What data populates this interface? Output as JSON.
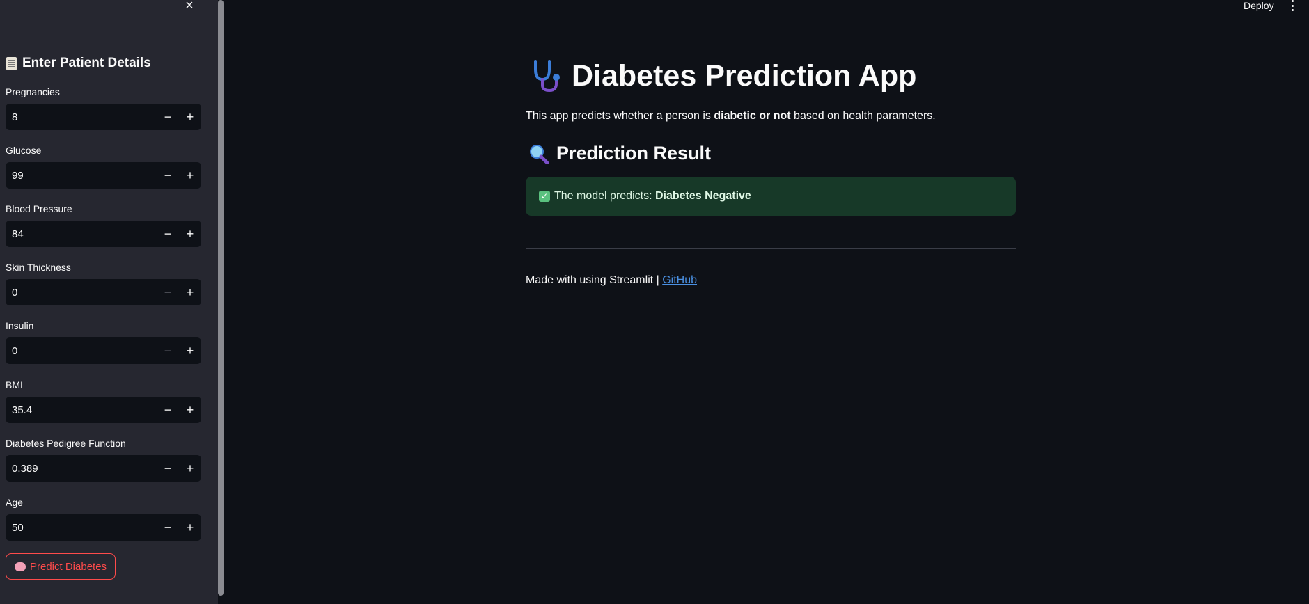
{
  "sidebar": {
    "close_icon": "×",
    "header": "Enter Patient Details",
    "fields": [
      {
        "label": "Pregnancies",
        "value": "8",
        "minus_enabled": true
      },
      {
        "label": "Glucose",
        "value": "99",
        "minus_enabled": true
      },
      {
        "label": "Blood Pressure",
        "value": "84",
        "minus_enabled": true
      },
      {
        "label": "Skin Thickness",
        "value": "0",
        "minus_enabled": false
      },
      {
        "label": "Insulin",
        "value": "0",
        "minus_enabled": false
      },
      {
        "label": "BMI",
        "value": "35.4",
        "minus_enabled": true
      },
      {
        "label": "Diabetes Pedigree Function",
        "value": "0.389",
        "minus_enabled": true
      },
      {
        "label": "Age",
        "value": "50",
        "minus_enabled": true
      }
    ],
    "minus_label": "−",
    "plus_label": "+",
    "predict_button": "Predict Diabetes"
  },
  "topbar": {
    "deploy": "Deploy"
  },
  "main": {
    "title": "Diabetes Prediction App",
    "intro_prefix": "This app predicts whether a person is ",
    "intro_bold": "diabetic or not",
    "intro_suffix": " based on health parameters.",
    "result_heading": "Prediction Result",
    "result_prefix": "The model predicts: ",
    "result_value": "Diabetes Negative",
    "footer_text": "Made with using Streamlit | ",
    "footer_link": "GitHub"
  },
  "colors": {
    "background": "#0e1117",
    "sidebar": "#262730",
    "accent": "#ff4b4b",
    "success_bg": "#173928",
    "link": "#4a90e2"
  }
}
